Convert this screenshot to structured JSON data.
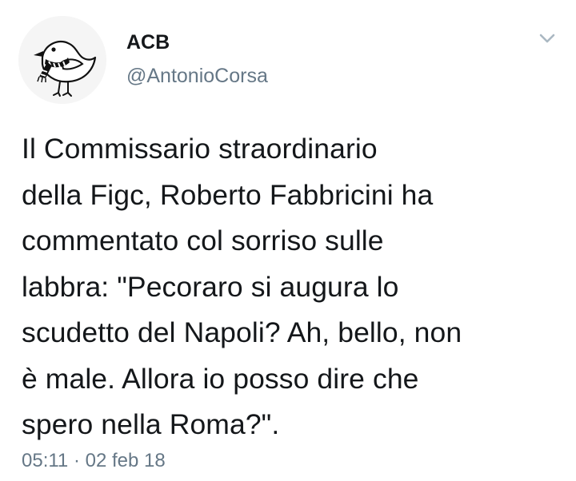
{
  "tweet": {
    "display_name": "ACB",
    "handle": "@AntonioCorsa",
    "text": "Il Commissario straordinario\ndella Figc, Roberto Fabbricini ha\ncommentato col sorriso sulle\nlabbra: \"Pecoraro si augura lo\nscudetto del Napoli? Ah, bello, non\nè male. Allora io posso dire che\nspero nella Roma?\".",
    "time": "05:11",
    "separator": "·",
    "date": "02 feb 18"
  },
  "icons": {
    "avatar": "bird-with-scarf-avatar",
    "menu": "chevron-down-icon"
  },
  "colors": {
    "primary_text": "#14171a",
    "secondary_text": "#657786",
    "caret": "#aab8c2",
    "background": "#ffffff"
  }
}
